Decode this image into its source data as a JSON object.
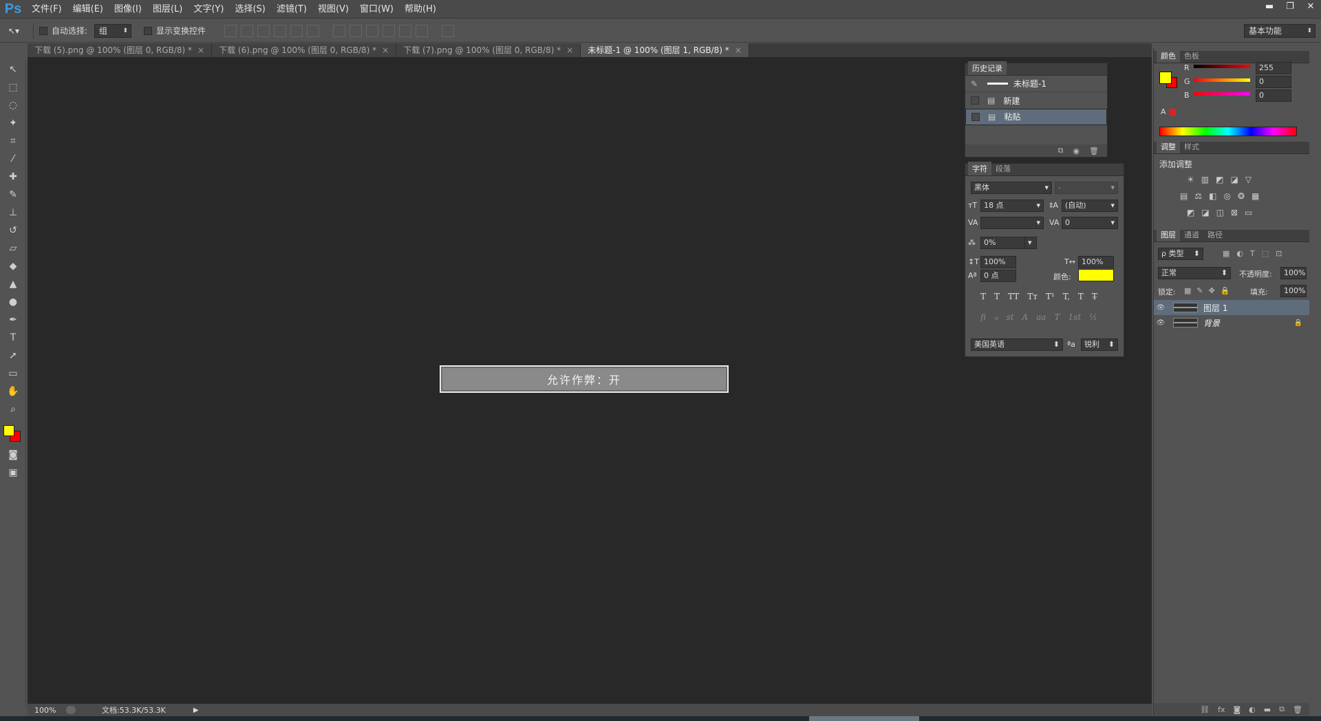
{
  "app": {
    "logo": "Ps"
  },
  "menu": [
    "文件(F)",
    "编辑(E)",
    "图像(I)",
    "图层(L)",
    "文字(Y)",
    "选择(S)",
    "滤镜(T)",
    "视图(V)",
    "窗口(W)",
    "帮助(H)"
  ],
  "window_controls": {
    "minimize": "▬",
    "restore": "❐",
    "close": "✕"
  },
  "options": {
    "auto_select_label": "自动选择:",
    "auto_select_value": "组",
    "show_transform_label": "显示变换控件",
    "workspace": "基本功能"
  },
  "tabs": [
    {
      "label": "下载 (5).png @ 100% (图层 0, RGB/8) *",
      "active": false
    },
    {
      "label": "下载 (6).png @ 100% (图层 0, RGB/8) *",
      "active": false
    },
    {
      "label": "下载 (7).png @ 100% (图层 0, RGB/8) *",
      "active": false
    },
    {
      "label": "未标题-1 @ 100% (图层 1, RGB/8) *",
      "active": true
    }
  ],
  "canvas": {
    "banner_text": "允许作弊：开"
  },
  "status": {
    "zoom": "100%",
    "doc_info": "文档:53.3K/53.3K"
  },
  "history": {
    "title": "历史记录",
    "snapshot": "未标题-1",
    "items": [
      "新建",
      "粘贴"
    ]
  },
  "character": {
    "tabs": [
      "字符",
      "段落"
    ],
    "font_family": "黑体",
    "font_style": "-",
    "size": "18 点",
    "leading": "(自动)",
    "tracking": "0",
    "scale_pct": "0%",
    "vscale": "100%",
    "hscale": "100%",
    "baseline": "0 点",
    "color_label": "颜色:",
    "color": "#ffff00",
    "style_buttons": [
      "T",
      "T",
      "TT",
      "Tт",
      "T¹",
      "T,",
      "T",
      "T̶"
    ],
    "opentype_buttons": [
      "fi",
      "ℴ",
      "st",
      "A",
      "aa",
      "T",
      "1st",
      "½"
    ],
    "language": "美国英语",
    "aa_label": "ªa",
    "antialias": "锐利"
  },
  "color_panel": {
    "tabs": [
      "颜色",
      "色板"
    ],
    "fg": "#ffff00",
    "bg": "#ff0000",
    "channels": [
      {
        "name": "R",
        "value": "255"
      },
      {
        "name": "G",
        "value": "0"
      },
      {
        "name": "B",
        "value": "0"
      }
    ]
  },
  "adjust_panel": {
    "tabs": [
      "调整",
      "样式"
    ],
    "title": "添加调整"
  },
  "layers_panel": {
    "tabs": [
      "图层",
      "通道",
      "路径"
    ],
    "filter": "ρ 类型",
    "blend": "正常",
    "opacity_label": "不透明度:",
    "opacity": "100%",
    "lock_label": "锁定:",
    "fill_label": "填充:",
    "fill": "100%",
    "layers": [
      {
        "name": "图层 1",
        "selected": true,
        "locked": false
      },
      {
        "name": "背景",
        "selected": false,
        "locked": true
      }
    ]
  }
}
